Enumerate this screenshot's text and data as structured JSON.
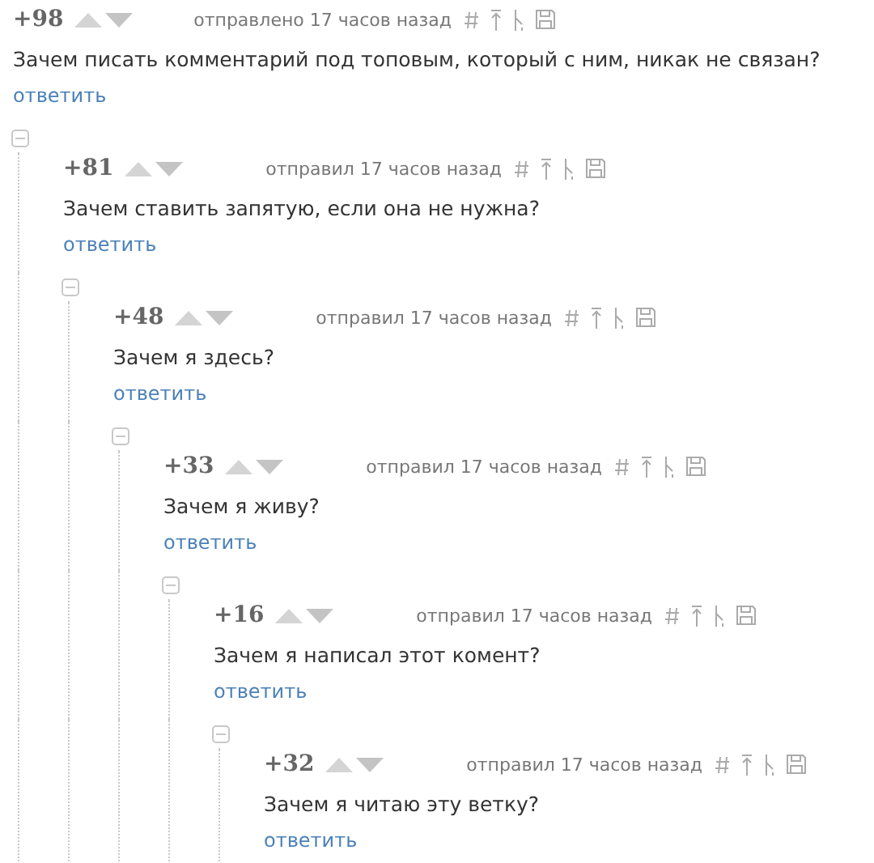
{
  "comments": [
    {
      "score": "+98",
      "time": "отправлено 17 часов назад",
      "text": "Зачем писать комментарий под топовым, который с ним, никак не связан?",
      "reply": "ответить",
      "children": [
        {
          "score": "+81",
          "time": "отправил 17 часов назад",
          "text": "Зачем ставить запятую, если она не нужна?",
          "reply": "ответить",
          "children": [
            {
              "score": "+48",
              "time": "отправил 17 часов назад",
              "text": "Зачем я здесь?",
              "reply": "ответить",
              "children": [
                {
                  "score": "+33",
                  "time": "отправил 17 часов назад",
                  "text": "Зачем я живу?",
                  "reply": "ответить",
                  "children": [
                    {
                      "score": "+16",
                      "time": "отправил 17 часов назад",
                      "text": "Зачем я написал этот комент?",
                      "reply": "ответить",
                      "children": [
                        {
                          "score": "+32",
                          "time": "отправил 17 часов назад",
                          "text": "Зачем я читаю эту ветку?",
                          "reply": "ответить"
                        }
                      ]
                    }
                  ]
                }
              ]
            }
          ]
        }
      ]
    }
  ]
}
